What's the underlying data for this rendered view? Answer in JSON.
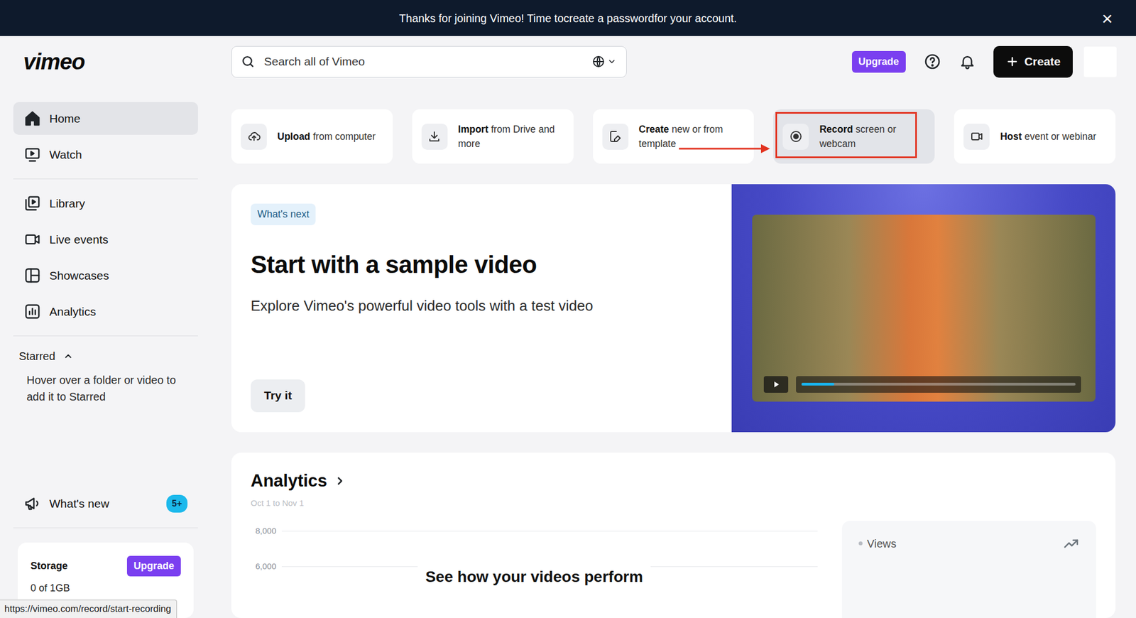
{
  "banner": {
    "before": "Thanks for joining Vimeo! Time to ",
    "link": "create a password",
    "after": " for your account.",
    "close": "×"
  },
  "logo": "vimeo",
  "search": {
    "placeholder": "Search all of Vimeo"
  },
  "header": {
    "upgrade": "Upgrade",
    "create": "Create"
  },
  "sidebar": {
    "primary": [
      {
        "label": "Home",
        "selected": true
      },
      {
        "label": "Watch",
        "selected": false
      }
    ],
    "secondary": [
      {
        "label": "Library",
        "selected": false
      },
      {
        "label": "Live events",
        "selected": false
      },
      {
        "label": "Showcases",
        "selected": false
      },
      {
        "label": "Analytics",
        "selected": false
      }
    ],
    "starred": {
      "label": "Starred",
      "expanded": true,
      "hint": "Hover over a folder or video to add it to Starred"
    },
    "whats_new": {
      "label": "What's new",
      "badge": "5+"
    },
    "storage": {
      "label": "Storage",
      "button": "Upgrade",
      "usage": "0 of 1GB"
    }
  },
  "actions": [
    {
      "bold": "Upload",
      "rest": "from computer",
      "selected": false
    },
    {
      "bold": "Import",
      "rest": "from Drive and more",
      "selected": false
    },
    {
      "bold": "Create",
      "rest": "new or from template",
      "selected": false
    },
    {
      "bold": "Record",
      "rest": "screen or webcam",
      "selected": true
    },
    {
      "bold": "Host",
      "rest": "event or webinar",
      "selected": false
    }
  ],
  "hero": {
    "tag": "What's next",
    "title": "Start with a sample video",
    "subtitle": "Explore Vimeo's powerful video tools with a test video",
    "button": "Try it",
    "video": {
      "playing": false,
      "level": 0.12
    }
  },
  "analytics": {
    "title": "Analytics",
    "range": "Oct 1 to Nov 1",
    "ticks": [
      "8,000",
      "6,000"
    ],
    "message": "See how your videos perform",
    "views": "Views"
  },
  "status_bar": "https://vimeo.com/record/start-recording"
}
